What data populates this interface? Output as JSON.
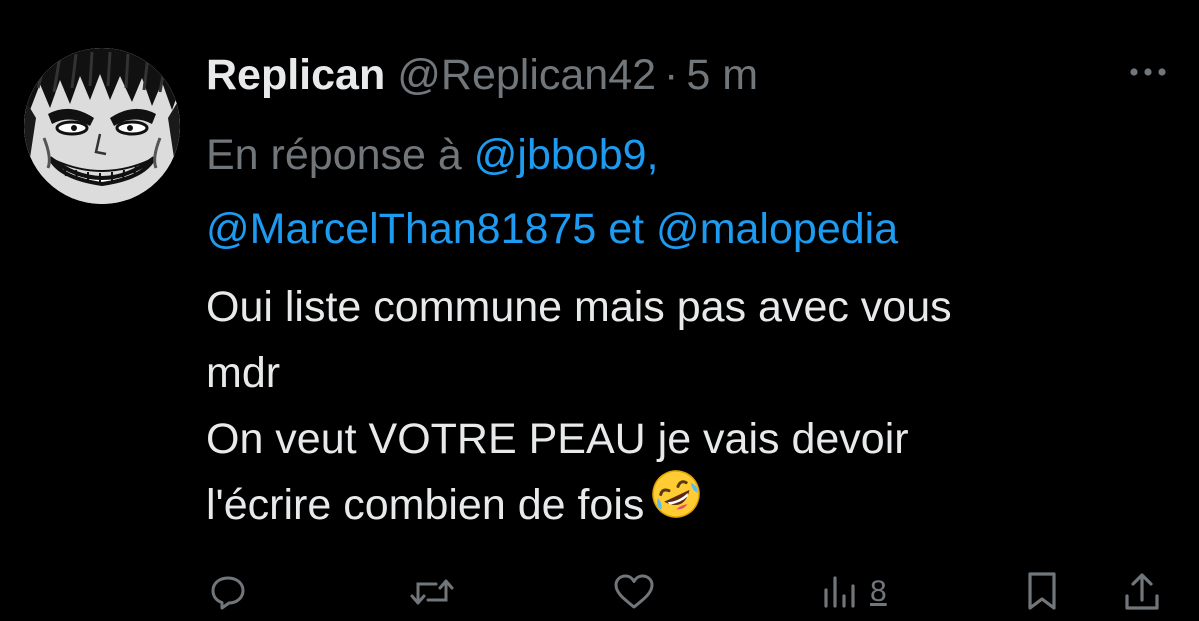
{
  "tweet": {
    "display_name": "Replican",
    "handle": "@Replican42",
    "separator": "·",
    "time": "5 m",
    "reply_prefix": "En réponse à",
    "mentions": [
      "@jbbob9",
      "@MarcelThan81875",
      "@malopedia"
    ],
    "mention_comma": ",",
    "mention_and": "et",
    "text_lines": [
      "Oui liste commune mais pas avec vous",
      "mdr",
      "On veut VOTRE PEAU je vais devoir",
      "l'écrire combien de fois"
    ],
    "emoji": "rolling-on-the-floor-laughing"
  },
  "actions": {
    "views": "8",
    "icons": [
      "reply-icon",
      "retweet-icon",
      "like-icon",
      "views-icon",
      "bookmark-icon",
      "share-icon"
    ]
  },
  "colors": {
    "background": "#000000",
    "primary_text": "#e7e9ea",
    "secondary_text": "#71767b",
    "link": "#1d9bf0"
  }
}
